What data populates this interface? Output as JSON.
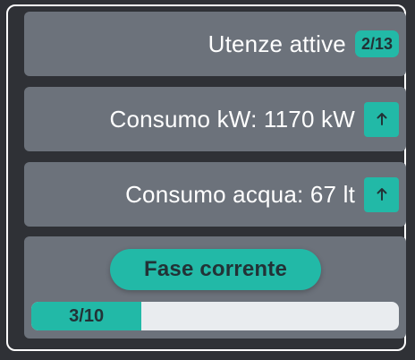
{
  "users": {
    "label": "Utenze attive",
    "badge": "2/13"
  },
  "power": {
    "label": "Consumo kW: 1170 kW",
    "action_icon": "arrow-up-icon"
  },
  "water": {
    "label": "Consumo acqua: 67 lt",
    "action_icon": "arrow-up-icon"
  },
  "phase": {
    "label": "Fase corrente",
    "progress_text": "3/10",
    "progress_fraction": 0.3
  },
  "colors": {
    "accent": "#22b9a7",
    "card": "#6c727b",
    "background": "#2f3136",
    "track": "#e9ecef"
  }
}
